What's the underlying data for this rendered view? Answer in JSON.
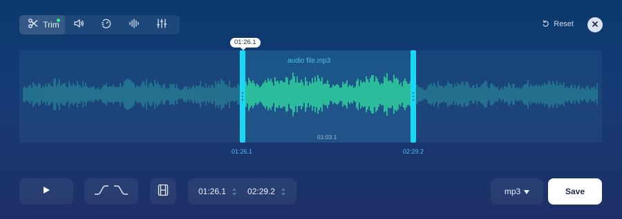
{
  "toolbar": {
    "tools": [
      {
        "label": "Trim",
        "icon": "scissors-icon",
        "active": true
      },
      {
        "label": "",
        "icon": "volume-icon"
      },
      {
        "label": "",
        "icon": "speed-icon"
      },
      {
        "label": "",
        "icon": "equalizer-icon"
      },
      {
        "label": "",
        "icon": "sliders-icon"
      }
    ],
    "reset_label": "Reset",
    "reset_icon": "undo-icon",
    "close_icon": "close-icon"
  },
  "waveform": {
    "file_name": "audio file.mp3",
    "selection_start": "01:26.1",
    "selection_end": "02:29.2",
    "selection_duration": "01:03.1",
    "playhead_time": "01:26.1",
    "colors": {
      "inactive_wave": "#2a8f9c",
      "active_wave": "#33f097",
      "handle": "#19d8f3",
      "accent": "#4cc3f0"
    }
  },
  "controls": {
    "play_icon": "play-icon",
    "fade_in_icon": "fade-in-icon",
    "fade_out_icon": "fade-out-icon",
    "split_icon": "split-icon",
    "start_time": "01:26.1",
    "end_time": "02:29.2",
    "format": "mp3",
    "save_label": "Save"
  }
}
